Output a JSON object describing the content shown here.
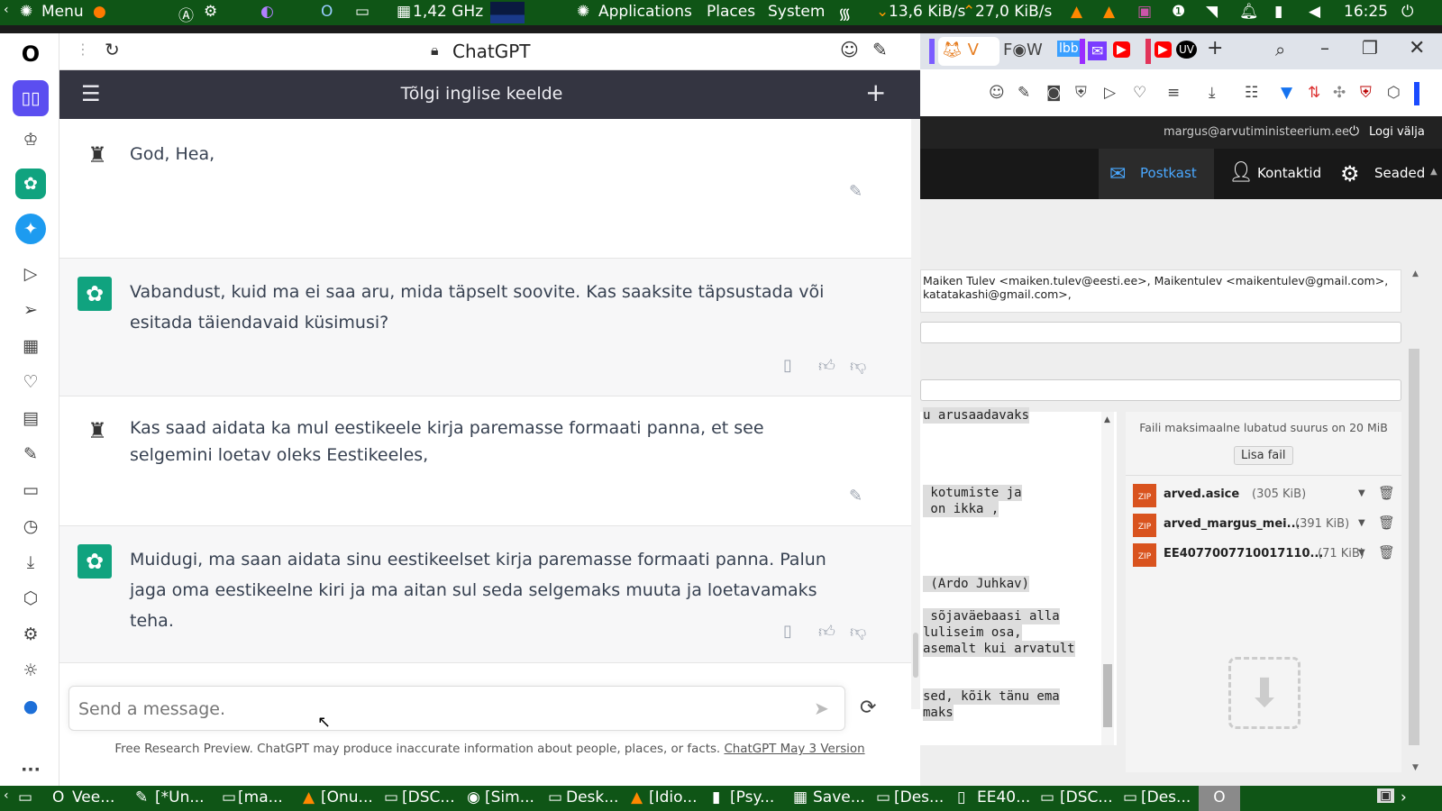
{
  "system_topbar": {
    "menu_label": "Menu",
    "cpu_freq": "1,42 GHz",
    "applications": "Applications",
    "places": "Places",
    "system": "System",
    "net_down": "13,6 KiB/s",
    "net_up": "27,0 KiB/s",
    "clock": "16:25"
  },
  "browser": {
    "tab_title": "ChatGPT"
  },
  "chatgpt": {
    "header_title": "Tõlgi inglise keelde",
    "messages": [
      {
        "role": "user",
        "text": "God, Hea,"
      },
      {
        "role": "assistant",
        "text": "Vabandust, kuid ma ei saa aru, mida täpselt soovite. Kas saaksite täpsustada või esitada täiendavaid küsimusi?"
      },
      {
        "role": "user",
        "text": "Kas saad aidata ka mul eestikeele kirja paremasse formaati panna, et see selgemini loetav oleks Eestikeeles,"
      },
      {
        "role": "assistant",
        "text": "Muidugi, ma saan aidata sinu eestikeelset kirja paremasse formaati panna. Palun jaga oma eestikeelne kiri ja ma aitan sul seda selgemaks muuta ja loetavamaks teha."
      }
    ],
    "input_placeholder": "Send a message.",
    "footer_text": "Free Research Preview. ChatGPT may produce inaccurate information about people, places, or facts. ",
    "footer_link": "ChatGPT May 3 Version"
  },
  "mail": {
    "user_email": "margus@arvutiministeerium.ee",
    "logout": "Logi välja",
    "nav": [
      {
        "label": "Postkast"
      },
      {
        "label": "Kontaktid"
      },
      {
        "label": "Seaded"
      }
    ],
    "recipients_line1": "Maiken Tulev <maiken.tulev@eesti.ee>, Maikentulev <maikentulev@gmail.com>,",
    "recipients_line2": "katatakashi@gmail.com>,",
    "body_fragments": [
      "u arusaadavaks",
      " kotumiste ja",
      " on ikka ,",
      " (Ardo Juhkav)",
      " sõjaväebaasi alla",
      "luliseim osa,",
      "asemalt kui arvatult",
      "sed, kõik tänu ema",
      "maks"
    ],
    "max_size_note": "Faili maksimaalne lubatud suurus on 20 MiB",
    "add_file": "Lisa fail",
    "attachments": [
      {
        "name": "arved.asice",
        "size": "(305 KiB)"
      },
      {
        "name": "arved_margus_mei...",
        "size": "(391 KiB)"
      },
      {
        "name": "EE4077007710017110...",
        "size": "(71 KiB)"
      }
    ]
  },
  "taskbar_items": [
    "Vee...",
    "[*Un...",
    "[ma...",
    "[Onu...",
    "[DSC...",
    "[Sim...",
    "Desk...",
    "[Idio...",
    "[Psy...",
    "Save...",
    "[Des...",
    "EE40...",
    "[DSC...",
    "[Des..."
  ]
}
